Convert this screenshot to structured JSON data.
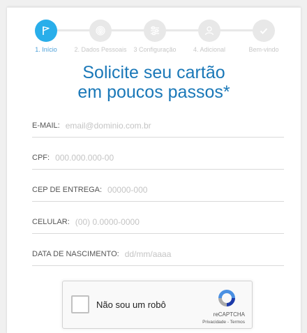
{
  "stepper": {
    "steps": [
      {
        "label": "1. Início",
        "icon": "flag-icon",
        "active": true
      },
      {
        "label": "2. Dados Pessoais",
        "icon": "fingerprint-icon",
        "active": false
      },
      {
        "label": "3 Configuração",
        "icon": "sliders-icon",
        "active": false
      },
      {
        "label": "4. Adicional",
        "icon": "user-icon",
        "active": false
      },
      {
        "label": "Bem-vindo",
        "icon": "check-icon",
        "active": false
      }
    ]
  },
  "heading": {
    "line1": "Solicite seu cartão",
    "line2": "em poucos passos*"
  },
  "form": {
    "email": {
      "label": "E-MAIL:",
      "placeholder": "email@dominio.com.br"
    },
    "cpf": {
      "label": "CPF:",
      "placeholder": "000.000.000-00"
    },
    "cep": {
      "label": "CEP DE ENTREGA:",
      "placeholder": "00000-000"
    },
    "celular": {
      "label": "CELULAR:",
      "placeholder": "(00) 0.0000-0000"
    },
    "nascimento": {
      "label": "DATA DE NASCIMENTO:",
      "placeholder": "dd/mm/aaaa"
    }
  },
  "captcha": {
    "label": "Não sou um robô",
    "brand": "reCAPTCHA",
    "links": "Privacidade - Termos"
  },
  "colors": {
    "accent": "#29aeea",
    "heading": "#1a78b8",
    "inactive": "#e8e8e8"
  }
}
